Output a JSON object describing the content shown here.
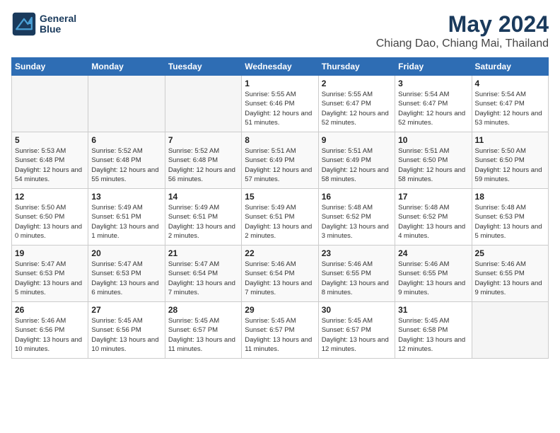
{
  "header": {
    "logo_line1": "General",
    "logo_line2": "Blue",
    "month": "May 2024",
    "location": "Chiang Dao, Chiang Mai, Thailand"
  },
  "weekdays": [
    "Sunday",
    "Monday",
    "Tuesday",
    "Wednesday",
    "Thursday",
    "Friday",
    "Saturday"
  ],
  "weeks": [
    [
      {
        "day": "",
        "empty": true
      },
      {
        "day": "",
        "empty": true
      },
      {
        "day": "",
        "empty": true
      },
      {
        "day": "1",
        "sunrise": "5:55 AM",
        "sunset": "6:46 PM",
        "daylight": "12 hours and 51 minutes."
      },
      {
        "day": "2",
        "sunrise": "5:55 AM",
        "sunset": "6:47 PM",
        "daylight": "12 hours and 52 minutes."
      },
      {
        "day": "3",
        "sunrise": "5:54 AM",
        "sunset": "6:47 PM",
        "daylight": "12 hours and 52 minutes."
      },
      {
        "day": "4",
        "sunrise": "5:54 AM",
        "sunset": "6:47 PM",
        "daylight": "12 hours and 53 minutes."
      }
    ],
    [
      {
        "day": "5",
        "sunrise": "5:53 AM",
        "sunset": "6:48 PM",
        "daylight": "12 hours and 54 minutes."
      },
      {
        "day": "6",
        "sunrise": "5:52 AM",
        "sunset": "6:48 PM",
        "daylight": "12 hours and 55 minutes."
      },
      {
        "day": "7",
        "sunrise": "5:52 AM",
        "sunset": "6:48 PM",
        "daylight": "12 hours and 56 minutes."
      },
      {
        "day": "8",
        "sunrise": "5:51 AM",
        "sunset": "6:49 PM",
        "daylight": "12 hours and 57 minutes."
      },
      {
        "day": "9",
        "sunrise": "5:51 AM",
        "sunset": "6:49 PM",
        "daylight": "12 hours and 58 minutes."
      },
      {
        "day": "10",
        "sunrise": "5:51 AM",
        "sunset": "6:50 PM",
        "daylight": "12 hours and 58 minutes."
      },
      {
        "day": "11",
        "sunrise": "5:50 AM",
        "sunset": "6:50 PM",
        "daylight": "12 hours and 59 minutes."
      }
    ],
    [
      {
        "day": "12",
        "sunrise": "5:50 AM",
        "sunset": "6:50 PM",
        "daylight": "13 hours and 0 minutes."
      },
      {
        "day": "13",
        "sunrise": "5:49 AM",
        "sunset": "6:51 PM",
        "daylight": "13 hours and 1 minute."
      },
      {
        "day": "14",
        "sunrise": "5:49 AM",
        "sunset": "6:51 PM",
        "daylight": "13 hours and 2 minutes."
      },
      {
        "day": "15",
        "sunrise": "5:49 AM",
        "sunset": "6:51 PM",
        "daylight": "13 hours and 2 minutes."
      },
      {
        "day": "16",
        "sunrise": "5:48 AM",
        "sunset": "6:52 PM",
        "daylight": "13 hours and 3 minutes."
      },
      {
        "day": "17",
        "sunrise": "5:48 AM",
        "sunset": "6:52 PM",
        "daylight": "13 hours and 4 minutes."
      },
      {
        "day": "18",
        "sunrise": "5:48 AM",
        "sunset": "6:53 PM",
        "daylight": "13 hours and 5 minutes."
      }
    ],
    [
      {
        "day": "19",
        "sunrise": "5:47 AM",
        "sunset": "6:53 PM",
        "daylight": "13 hours and 5 minutes."
      },
      {
        "day": "20",
        "sunrise": "5:47 AM",
        "sunset": "6:53 PM",
        "daylight": "13 hours and 6 minutes."
      },
      {
        "day": "21",
        "sunrise": "5:47 AM",
        "sunset": "6:54 PM",
        "daylight": "13 hours and 7 minutes."
      },
      {
        "day": "22",
        "sunrise": "5:46 AM",
        "sunset": "6:54 PM",
        "daylight": "13 hours and 7 minutes."
      },
      {
        "day": "23",
        "sunrise": "5:46 AM",
        "sunset": "6:55 PM",
        "daylight": "13 hours and 8 minutes."
      },
      {
        "day": "24",
        "sunrise": "5:46 AM",
        "sunset": "6:55 PM",
        "daylight": "13 hours and 9 minutes."
      },
      {
        "day": "25",
        "sunrise": "5:46 AM",
        "sunset": "6:55 PM",
        "daylight": "13 hours and 9 minutes."
      }
    ],
    [
      {
        "day": "26",
        "sunrise": "5:46 AM",
        "sunset": "6:56 PM",
        "daylight": "13 hours and 10 minutes."
      },
      {
        "day": "27",
        "sunrise": "5:45 AM",
        "sunset": "6:56 PM",
        "daylight": "13 hours and 10 minutes."
      },
      {
        "day": "28",
        "sunrise": "5:45 AM",
        "sunset": "6:57 PM",
        "daylight": "13 hours and 11 minutes."
      },
      {
        "day": "29",
        "sunrise": "5:45 AM",
        "sunset": "6:57 PM",
        "daylight": "13 hours and 11 minutes."
      },
      {
        "day": "30",
        "sunrise": "5:45 AM",
        "sunset": "6:57 PM",
        "daylight": "13 hours and 12 minutes."
      },
      {
        "day": "31",
        "sunrise": "5:45 AM",
        "sunset": "6:58 PM",
        "daylight": "13 hours and 12 minutes."
      },
      {
        "day": "",
        "empty": true
      }
    ]
  ]
}
